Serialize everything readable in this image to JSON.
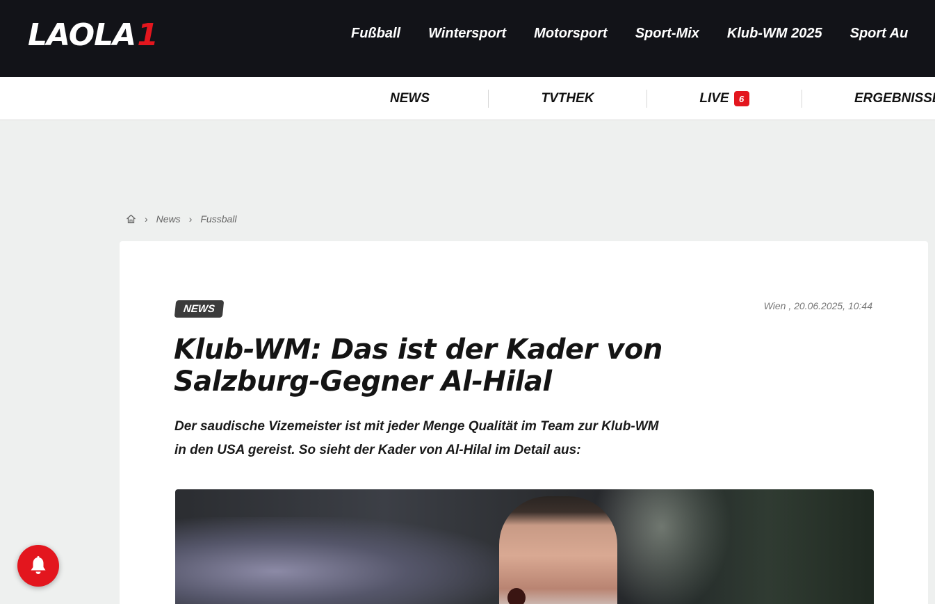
{
  "logo": {
    "text": "LAOLA",
    "accent": "1"
  },
  "main_nav": [
    {
      "label": "Fußball"
    },
    {
      "label": "Wintersport"
    },
    {
      "label": "Motorsport"
    },
    {
      "label": "Sport-Mix"
    },
    {
      "label": "Klub-WM 2025"
    },
    {
      "label": "Sport Au"
    }
  ],
  "sub_nav": {
    "news": "NEWS",
    "tvthek": "TVTHEK",
    "live": "LIVE",
    "live_count": "6",
    "ergebnisse": "ERGEBNISSE"
  },
  "breadcrumb": {
    "home_icon": "home-icon",
    "items": [
      "News",
      "Fussball"
    ]
  },
  "article": {
    "badge": "NEWS",
    "dateline": "Wien , 20.06.2025, 10:44",
    "headline_line1": "Klub-WM: Das ist der Kader von",
    "headline_line2": "Salzburg-Gegner Al-Hilal",
    "lead_line1": "Der saudische Vizemeister ist mit jeder Menge Qualität im Team zur Klub-WM",
    "lead_line2": "in den USA gereist. So sieht der Kader von Al-Hilal im Detail aus:"
  },
  "notification": {
    "icon": "bell-icon"
  },
  "colors": {
    "brand_red": "#e3161e",
    "topbar_bg": "#121318",
    "page_bg": "#eef0ef"
  }
}
